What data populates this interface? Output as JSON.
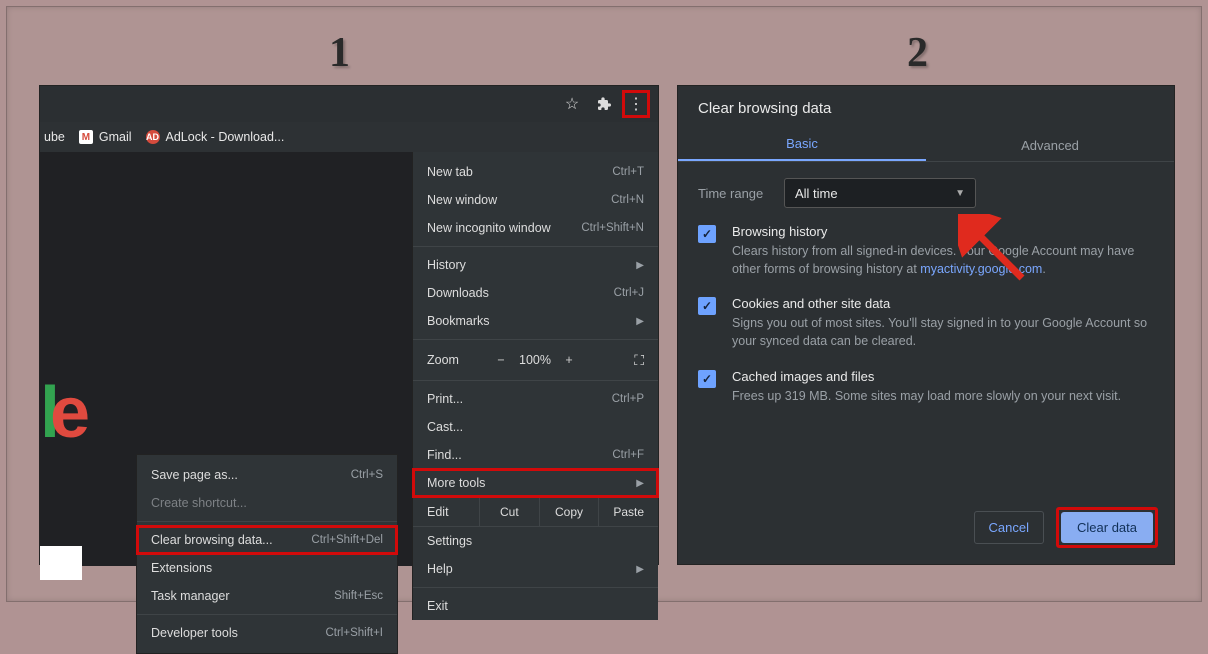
{
  "steps": {
    "one": "1",
    "two": "2"
  },
  "bookmarks": {
    "ube": "ube",
    "gmail": "Gmail",
    "gmail_icon": "M",
    "adlock": "AdLock - Download...",
    "adlock_icon": "AD"
  },
  "logo": {
    "l": "l",
    "e": "e"
  },
  "menu": {
    "new_tab": "New tab",
    "new_tab_sc": "Ctrl+T",
    "new_window": "New window",
    "new_window_sc": "Ctrl+N",
    "new_incognito": "New incognito window",
    "new_incognito_sc": "Ctrl+Shift+N",
    "history": "History",
    "downloads": "Downloads",
    "downloads_sc": "Ctrl+J",
    "bookmarks": "Bookmarks",
    "zoom": "Zoom",
    "zoom_minus": "−",
    "zoom_val": "100%",
    "zoom_plus": "+",
    "print": "Print...",
    "print_sc": "Ctrl+P",
    "cast": "Cast...",
    "find": "Find...",
    "find_sc": "Ctrl+F",
    "more_tools": "More tools",
    "edit": "Edit",
    "cut": "Cut",
    "copy": "Copy",
    "paste": "Paste",
    "settings": "Settings",
    "help": "Help",
    "exit": "Exit"
  },
  "submenu": {
    "save_as": "Save page as...",
    "save_as_sc": "Ctrl+S",
    "create_shortcut": "Create shortcut...",
    "clear_bd": "Clear browsing data...",
    "clear_bd_sc": "Ctrl+Shift+Del",
    "extensions": "Extensions",
    "task_mgr": "Task manager",
    "task_mgr_sc": "Shift+Esc",
    "dev_tools": "Developer tools",
    "dev_tools_sc": "Ctrl+Shift+I"
  },
  "dialog": {
    "title": "Clear browsing data",
    "tab_basic": "Basic",
    "tab_advanced": "Advanced",
    "time_range_label": "Time range",
    "time_range_value": "All time",
    "opt1_title": "Browsing history",
    "opt1_desc_a": "Clears history from all signed-in devices. Your Google Account may have other forms of browsing history at ",
    "opt1_link": "myactivity.google.com",
    "opt1_desc_b": ".",
    "opt2_title": "Cookies and other site data",
    "opt2_desc": "Signs you out of most sites. You'll stay signed in to your Google Account so your synced data can be cleared.",
    "opt3_title": "Cached images and files",
    "opt3_desc": "Frees up 319 MB. Some sites may load more slowly on your next visit.",
    "cancel": "Cancel",
    "clear": "Clear data"
  }
}
